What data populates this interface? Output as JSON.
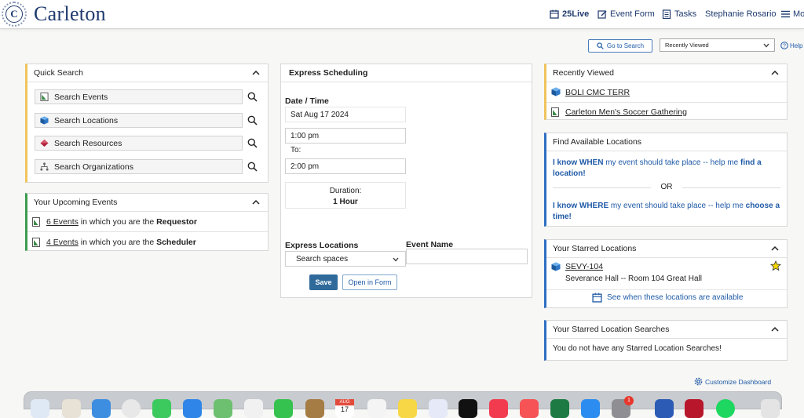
{
  "header": {
    "brand": "Carleton",
    "seal_letter": "C",
    "nav": [
      {
        "label": "25Live",
        "icon": "calendar-icon"
      },
      {
        "label": "Event Form",
        "icon": "edit-icon"
      },
      {
        "label": "Tasks",
        "icon": "tasks-icon"
      },
      {
        "label": "Stephanie Rosario",
        "icon": ""
      },
      {
        "label": "Mor",
        "icon": "menu-icon"
      }
    ]
  },
  "toolbar": {
    "go_to_search": "Go to Search",
    "recently_viewed_select": "Recently Viewed",
    "help": "Help"
  },
  "quick_search": {
    "title": "Quick Search",
    "items": [
      {
        "label": "Search Events",
        "icon": "event-icon"
      },
      {
        "label": "Search Locations",
        "icon": "location-cube-icon"
      },
      {
        "label": "Search Resources",
        "icon": "resource-icon"
      },
      {
        "label": "Search Organizations",
        "icon": "organization-icon"
      }
    ]
  },
  "upcoming": {
    "title": "Your Upcoming Events",
    "rows": [
      {
        "link": "6 Events",
        "text": " in which you are the ",
        "role": "Requestor"
      },
      {
        "link": "4 Events",
        "text": " in which you are the ",
        "role": "Scheduler"
      }
    ]
  },
  "express": {
    "title": "Express Scheduling",
    "date_time_label": "Date / Time",
    "date": "Sat Aug 17 2024",
    "start": "1:00 pm",
    "to": "To:",
    "end": "2:00 pm",
    "duration_label": "Duration:",
    "duration": "1 Hour",
    "locations_label": "Express Locations",
    "locations_placeholder": "Search spaces",
    "event_name_label": "Event Name",
    "event_name_value": "",
    "save": "Save",
    "open_in_form": "Open in Form"
  },
  "recently_viewed": {
    "title": "Recently Viewed",
    "items": [
      {
        "label": "BOLI CMC TERR",
        "icon": "location-cube-icon"
      },
      {
        "label": "Carleton Men's Soccer Gathering",
        "icon": "event-icon"
      }
    ]
  },
  "find_locations": {
    "title": "Find Available Locations",
    "when_bold": "I know WHEN",
    "when_text": " my event should take place -- help me ",
    "when_action": "find a location!",
    "or": "OR",
    "where_bold": "I know WHERE",
    "where_text": " my event should take place -- help me ",
    "where_action": "choose a time!"
  },
  "starred_locations": {
    "title": "Your Starred Locations",
    "item_name": "SEVY-104",
    "item_desc": "Severance Hall -- Room 104 Great Hall",
    "see_when": "See when these locations are available"
  },
  "starred_searches": {
    "title": "Your Starred Location Searches",
    "empty": "You do not have any Starred Location Searches!"
  },
  "customize": "Customize Dashboard",
  "dock": {
    "calendar_month": "AUG",
    "calendar_day": "17",
    "badge": "1"
  },
  "colors": {
    "brand": "#1f3a6e",
    "link": "#1f5aa6",
    "save_button": "#2f6a9b",
    "quick_search_accent": "#f0c45c",
    "upcoming_accent": "#3c9b4d",
    "info_accent": "#2e6fc4"
  }
}
